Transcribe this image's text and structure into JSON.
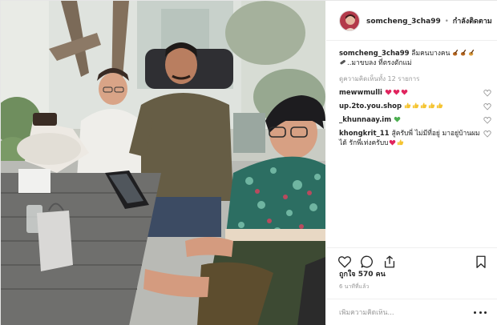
{
  "post": {
    "author": {
      "username": "somcheng_3cha99",
      "separator": "•",
      "follow_status": "กำลังติดตาม"
    },
    "caption": {
      "username": "somcheng_3cha99",
      "line1": "ลืมคนบางคน",
      "line2": "..มาขบลง ที่ตรงตักแม่",
      "emojis": [
        "guitar",
        "guitar",
        "guitar",
        "pill"
      ]
    },
    "view_all_comments": "ดูความคิดเห็นทั้ง 12 รายการ",
    "comments": [
      {
        "username": "mewwmulli",
        "text": "",
        "emoji": [
          "red-heart",
          "red-heart",
          "red-heart"
        ]
      },
      {
        "username": "up.2to.you.shop",
        "text": "",
        "emoji": [
          "thumbs-up",
          "thumbs-up",
          "thumbs-up",
          "thumbs-up",
          "thumbs-up"
        ]
      },
      {
        "username": "_khunnaay.im",
        "text": "",
        "emoji": [
          "green-heart"
        ]
      },
      {
        "username": "khongkrit_11",
        "text": "สู้ครับพี่ ไม่มีที่อยู่ มาอยู่บ้านผมได้ รักพี่เท่งครับบ",
        "emoji": [
          "red-heart",
          "thumbs-up"
        ]
      }
    ],
    "likes_text": "ถูกใจ 570 คน",
    "time_ago": "6 นาทีที่แล้ว",
    "add_comment_placeholder": "เพิ่มความคิดเห็น...",
    "icons": {
      "like": "heart-outline-icon",
      "comment": "comment-bubble-icon",
      "share": "share-icon",
      "save": "bookmark-icon",
      "more": "more-options-icon"
    },
    "colors": {
      "text": "#262626",
      "muted": "#999999",
      "border": "#efefef",
      "heart_red": "#e0245e",
      "thumb_yellow": "#f5c431",
      "heart_green": "#4caf50"
    }
  }
}
